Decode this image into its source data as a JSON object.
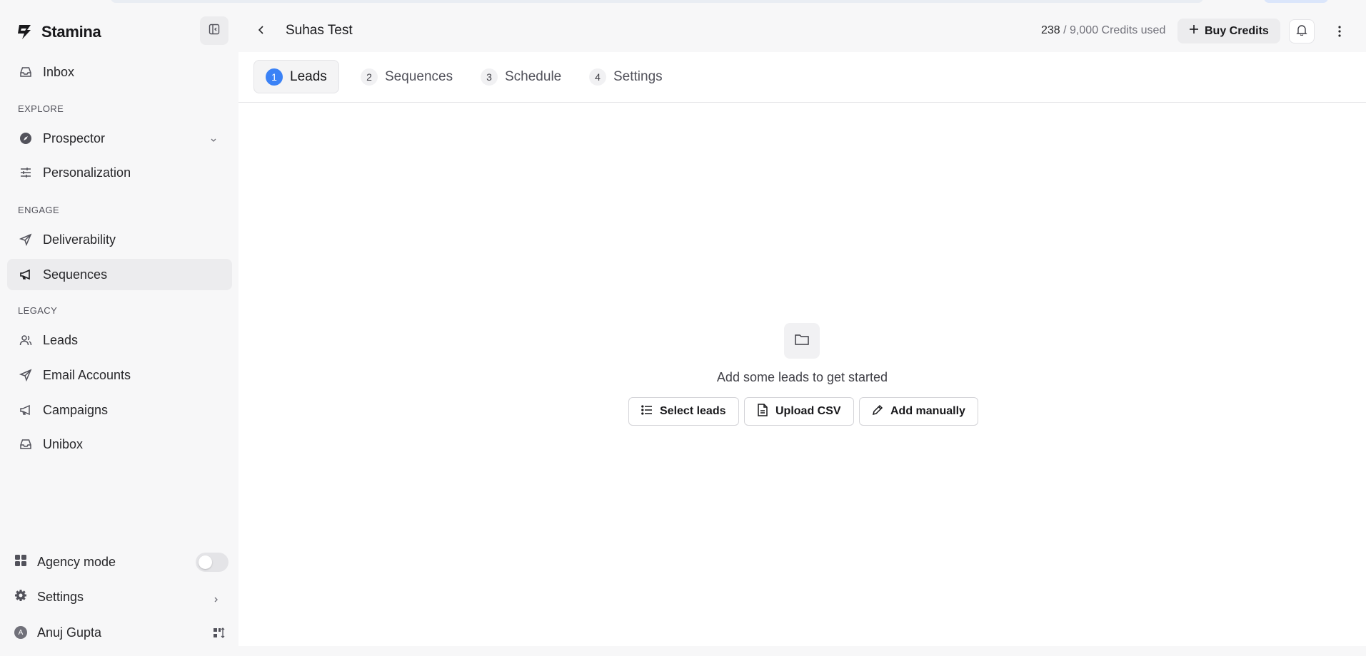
{
  "brand": {
    "name": "Stamina"
  },
  "sidebar": {
    "inbox": "Inbox",
    "sections": {
      "explore": "EXPLORE",
      "engage": "ENGAGE",
      "legacy": "LEGACY"
    },
    "items": [
      {
        "label": "Prospector",
        "icon": "compass-icon"
      },
      {
        "label": "Personalization",
        "icon": "sliders-icon"
      },
      {
        "label": "Deliverability",
        "icon": "send-icon"
      },
      {
        "label": "Sequences",
        "icon": "megaphone-icon",
        "active": true
      },
      {
        "label": "Leads",
        "icon": "users-icon"
      },
      {
        "label": "Email Accounts",
        "icon": "send-icon"
      },
      {
        "label": "Campaigns",
        "icon": "megaphone-icon"
      },
      {
        "label": "Unibox",
        "icon": "inbox-icon"
      }
    ],
    "bottom": {
      "agency_mode": "Agency mode",
      "agency_mode_on": false,
      "settings": "Settings",
      "user_name": "Anuj Gupta",
      "user_initial": "A"
    }
  },
  "header": {
    "title": "Suhas Test",
    "credits_used": "238",
    "credits_rest": "/ 9,000 Credits used",
    "buy_credits": "Buy Credits"
  },
  "tabs": [
    {
      "num": "1",
      "label": "Leads",
      "active": true
    },
    {
      "num": "2",
      "label": "Sequences"
    },
    {
      "num": "3",
      "label": "Schedule"
    },
    {
      "num": "4",
      "label": "Settings"
    }
  ],
  "empty_state": {
    "message": "Add some leads to get started",
    "actions": [
      "Select leads",
      "Upload CSV",
      "Add manually"
    ]
  },
  "colors": {
    "accent": "#3b82f6"
  }
}
